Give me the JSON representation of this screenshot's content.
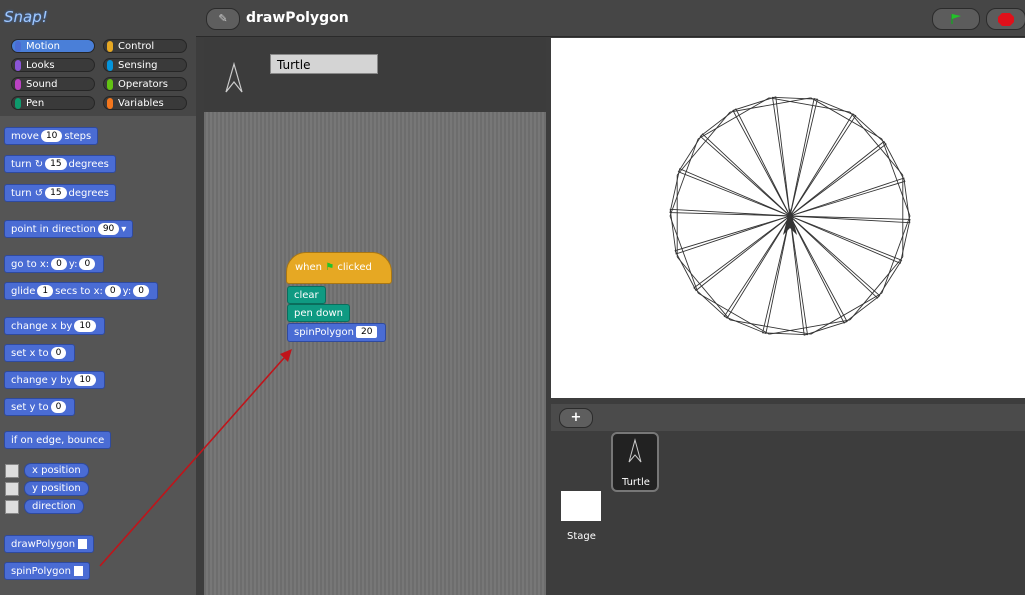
{
  "app": {
    "logo": "Snap!",
    "project_title": "drawPolygon"
  },
  "categories": [
    {
      "label": "Motion",
      "color": "#4a6cd4",
      "selected": true
    },
    {
      "label": "Control",
      "color": "#e6a823"
    },
    {
      "label": "Looks",
      "color": "#8a55d7"
    },
    {
      "label": "Sensing",
      "color": "#0494dc"
    },
    {
      "label": "Sound",
      "color": "#bb42c3"
    },
    {
      "label": "Operators",
      "color": "#62c213"
    },
    {
      "label": "Pen",
      "color": "#0e9a6c"
    },
    {
      "label": "Variables",
      "color": "#f3761d"
    }
  ],
  "palette": {
    "move": {
      "pre": "move",
      "val": "10",
      "post": "steps"
    },
    "turn_cw": {
      "pre": "turn ↻",
      "val": "15",
      "post": "degrees"
    },
    "turn_ccw": {
      "pre": "turn ↺",
      "val": "15",
      "post": "degrees"
    },
    "point": {
      "pre": "point in direction",
      "val": "90"
    },
    "goto": {
      "pre": "go to x:",
      "x": "0",
      "mid": "y:",
      "y": "0"
    },
    "glide": {
      "pre": "glide",
      "secs": "1",
      "mid1": "secs to x:",
      "x": "0",
      "mid2": "y:",
      "y": "0"
    },
    "change_x": {
      "pre": "change x by",
      "val": "10"
    },
    "set_x": {
      "pre": "set x to",
      "val": "0"
    },
    "change_y": {
      "pre": "change y by",
      "val": "10"
    },
    "set_y": {
      "pre": "set y to",
      "val": "0"
    },
    "bounce": "if on edge, bounce",
    "reporters": [
      "x position",
      "y position",
      "direction"
    ],
    "custom": [
      "drawPolygon",
      "spinPolygon"
    ]
  },
  "sprite": {
    "name": "Turtle"
  },
  "script": {
    "hat_pre": "when",
    "hat_post": "clicked",
    "clear": "clear",
    "pen_down": "pen down",
    "spin_label": "spinPolygon",
    "spin_val": "20"
  },
  "corral": {
    "sprite_label": "Turtle",
    "stage_label": "Stage"
  },
  "stage_drawing": {
    "polygon_sides": 20,
    "spin_copies": 18
  }
}
